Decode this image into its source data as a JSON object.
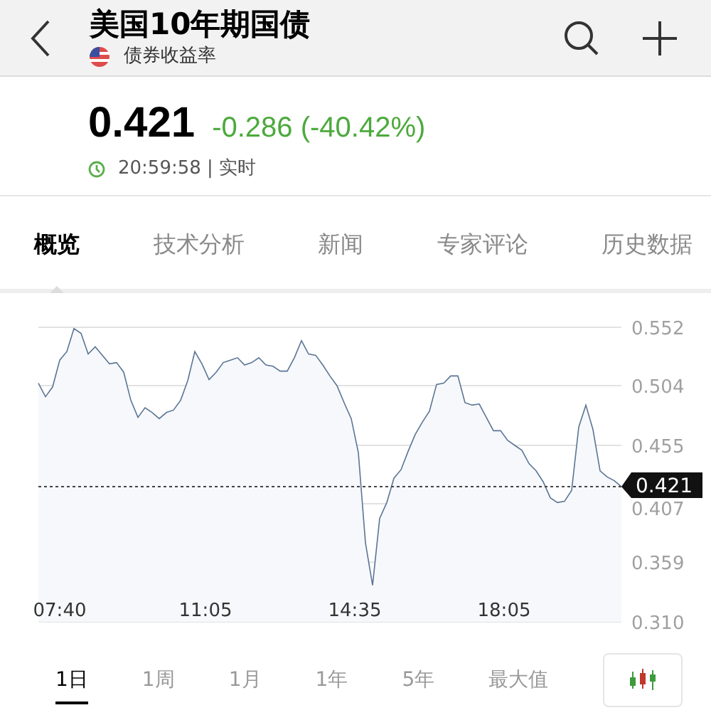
{
  "header": {
    "title": "美国10年期国债",
    "subtitle": "债券收益率"
  },
  "quote": {
    "price": "0.421",
    "change": "-0.286 (-40.42%)",
    "time": "20:59:58 | 实时"
  },
  "tabs": [
    {
      "label": "概览",
      "selected": true
    },
    {
      "label": "技术分析",
      "selected": false
    },
    {
      "label": "新闻",
      "selected": false
    },
    {
      "label": "专家评论",
      "selected": false
    },
    {
      "label": "历史数据",
      "selected": false
    }
  ],
  "chart": {
    "chart_data": {
      "type": "area",
      "x": [
        430,
        440,
        450,
        460,
        470,
        480,
        490,
        500,
        510,
        520,
        530,
        540,
        550,
        560,
        570,
        580,
        590,
        600,
        610,
        620,
        630,
        640,
        650,
        660,
        670,
        680,
        690,
        700,
        710,
        720,
        730,
        740,
        750,
        760,
        770,
        780,
        790,
        800,
        810,
        820,
        830,
        840,
        850,
        860,
        870,
        880,
        890,
        900,
        910,
        920,
        930,
        940,
        950,
        960,
        970,
        980,
        990,
        1000,
        1010,
        1020,
        1030,
        1040,
        1050,
        1060,
        1070,
        1080,
        1090,
        1100,
        1110,
        1120,
        1130,
        1140,
        1150,
        1160,
        1170,
        1180,
        1190,
        1200,
        1210,
        1220,
        1230,
        1240,
        1250
      ],
      "grid": true,
      "series": [
        {
          "color": "#5b7594",
          "values": [
            0.506,
            0.495,
            0.503,
            0.525,
            0.532,
            0.551,
            0.547,
            0.53,
            0.536,
            0.529,
            0.522,
            0.523,
            0.515,
            0.492,
            0.478,
            0.486,
            0.482,
            0.477,
            0.482,
            0.484,
            0.492,
            0.508,
            0.532,
            0.522,
            0.509,
            0.515,
            0.523,
            0.525,
            0.527,
            0.521,
            0.523,
            0.527,
            0.521,
            0.52,
            0.516,
            0.516,
            0.527,
            0.541,
            0.53,
            0.529,
            0.521,
            0.512,
            0.504,
            0.49,
            0.477,
            0.449,
            0.375,
            0.34,
            0.395,
            0.408,
            0.428,
            0.435,
            0.45,
            0.464,
            0.474,
            0.483,
            0.505,
            0.506,
            0.512,
            0.512,
            0.49,
            0.488,
            0.489,
            0.478,
            0.467,
            0.467,
            0.459,
            0.455,
            0.451,
            0.44,
            0.434,
            0.425,
            0.412,
            0.408,
            0.409,
            0.418,
            0.47,
            0.488,
            0.468,
            0.434,
            0.429,
            0.426,
            0.421
          ]
        }
      ],
      "xlim": [
        430,
        1250
      ],
      "ylim": [
        0.31,
        0.552
      ],
      "xticks": [
        {
          "value": 460,
          "label": "07:40"
        },
        {
          "value": 665,
          "label": "11:05"
        },
        {
          "value": 875,
          "label": "14:35"
        },
        {
          "value": 1085,
          "label": "18:05"
        }
      ],
      "yticks": [
        {
          "value": 0.552,
          "label": "0.552"
        },
        {
          "value": 0.504,
          "label": "0.504"
        },
        {
          "value": 0.455,
          "label": "0.455"
        },
        {
          "value": 0.407,
          "label": "0.407"
        },
        {
          "value": 0.359,
          "label": "0.359"
        },
        {
          "value": 0.31,
          "label": "0.310"
        }
      ],
      "ref_lines": [
        {
          "axis": "y",
          "value": 0.421,
          "label": "0.421"
        }
      ]
    }
  },
  "ranges": [
    {
      "label": "1日",
      "selected": true
    },
    {
      "label": "1周",
      "selected": false
    },
    {
      "label": "1月",
      "selected": false
    },
    {
      "label": "1年",
      "selected": false
    },
    {
      "label": "5年",
      "selected": false
    },
    {
      "label": "最大值",
      "selected": false
    }
  ]
}
